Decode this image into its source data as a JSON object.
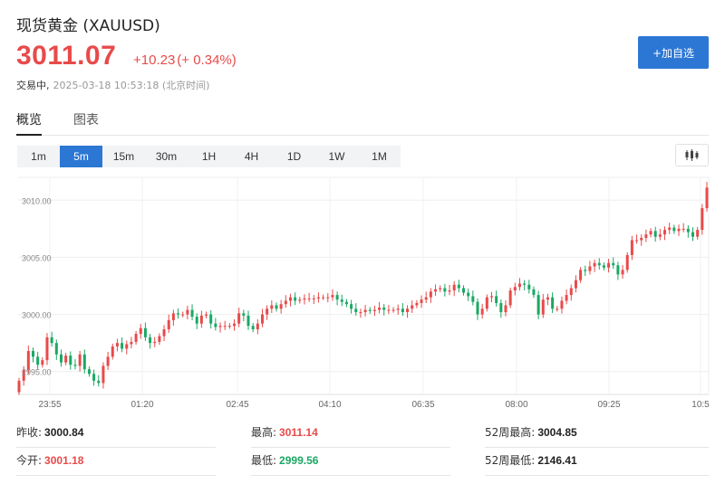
{
  "header": {
    "title": "现货黄金 (XAUUSD)",
    "price": "3011.07",
    "change": "+10.23",
    "change_pct": "(+ 0.34%)",
    "status": "交易中,",
    "timestamp": "2025-03-18 10:53:18 (北京时间)",
    "add_button": "+加自选"
  },
  "tabs": [
    {
      "label": "概览",
      "active": true
    },
    {
      "label": "图表",
      "active": false
    }
  ],
  "periods": [
    {
      "label": "1m",
      "active": false
    },
    {
      "label": "5m",
      "active": true
    },
    {
      "label": "15m",
      "active": false
    },
    {
      "label": "30m",
      "active": false
    },
    {
      "label": "1H",
      "active": false
    },
    {
      "label": "4H",
      "active": false
    },
    {
      "label": "1D",
      "active": false
    },
    {
      "label": "1W",
      "active": false
    },
    {
      "label": "1M",
      "active": false
    }
  ],
  "chart_type_icon": "candlestick-icon",
  "colors": {
    "up": "#e84a4a",
    "down": "#1aa865",
    "accent": "#2c77d4"
  },
  "chart_data": {
    "type": "candlestick",
    "y_ticks": [
      "3010.00",
      "3005.00",
      "3000.00",
      "2995.00"
    ],
    "x_ticks": [
      "23:55",
      "01:20",
      "02:45",
      "04:10",
      "06:35",
      "08:00",
      "09:25",
      "10:5"
    ],
    "ylim": [
      2993.0,
      3012.0
    ],
    "grid": true,
    "closes": [
      2994.2,
      2995.1,
      2996.8,
      2996.3,
      2995.6,
      2996.0,
      2998.0,
      2997.5,
      2996.5,
      2995.8,
      2996.4,
      2995.6,
      2995.5,
      2996.5,
      2995.2,
      2994.8,
      2994.2,
      2994.0,
      2995.5,
      2996.3,
      2997.2,
      2997.5,
      2997.0,
      2997.4,
      2997.6,
      2998.3,
      2998.8,
      2998.0,
      2997.5,
      2997.6,
      2998.1,
      2998.7,
      2999.5,
      3000.1,
      3000.0,
      3000.0,
      3000.4,
      2999.8,
      2999.2,
      2999.9,
      3000.0,
      2999.2,
      2998.9,
      2999.0,
      2999.0,
      2999.0,
      2999.2,
      3000.1,
      2999.9,
      2999.0,
      2998.7,
      2999.2,
      3000.0,
      3000.5,
      3000.8,
      3000.5,
      3000.9,
      3001.2,
      3001.5,
      3001.2,
      3001.3,
      3001.4,
      3001.4,
      3001.4,
      3001.5,
      3001.5,
      3001.5,
      3001.7,
      3001.3,
      3001.1,
      3000.9,
      3000.5,
      3000.2,
      3000.2,
      3000.4,
      3000.3,
      3000.4,
      3000.6,
      3000.4,
      3000.4,
      3000.4,
      3000.5,
      3000.2,
      3000.5,
      3000.8,
      3001.0,
      3001.3,
      3001.5,
      3002.0,
      3002.2,
      3002.3,
      3002.0,
      3002.1,
      3002.6,
      3002.3,
      3001.9,
      3001.6,
      3001.1,
      3000.0,
      3000.5,
      3001.5,
      3001.6,
      3001.0,
      3000.2,
      3000.8,
      3002.1,
      3002.4,
      3002.7,
      3002.6,
      3002.2,
      3001.7,
      3000.0,
      3001.3,
      3001.5,
      3000.5,
      3000.5,
      3001.2,
      3001.7,
      3002.3,
      3003.0,
      3003.9,
      3003.8,
      3004.2,
      3004.5,
      3004.3,
      3004.1,
      3004.5,
      3004.3,
      3003.5,
      3003.9,
      3005.2,
      3006.5,
      3006.5,
      3006.7,
      3007.0,
      3007.3,
      3006.8,
      3007.0,
      3007.4,
      3007.6,
      3007.3,
      3007.5,
      3007.5,
      3007.2,
      3006.8,
      3007.4,
      3009.3,
      3011.1
    ]
  },
  "stats": {
    "prev_close": {
      "label": "昨收:",
      "value": "3000.84"
    },
    "high": {
      "label": "最高:",
      "value": "3011.14"
    },
    "high_52w": {
      "label": "52周最高:",
      "value": "3004.85"
    },
    "open": {
      "label": "今开:",
      "value": "3001.18"
    },
    "low": {
      "label": "最低:",
      "value": "2999.56"
    },
    "low_52w": {
      "label": "52周最低:",
      "value": "2146.41"
    }
  }
}
